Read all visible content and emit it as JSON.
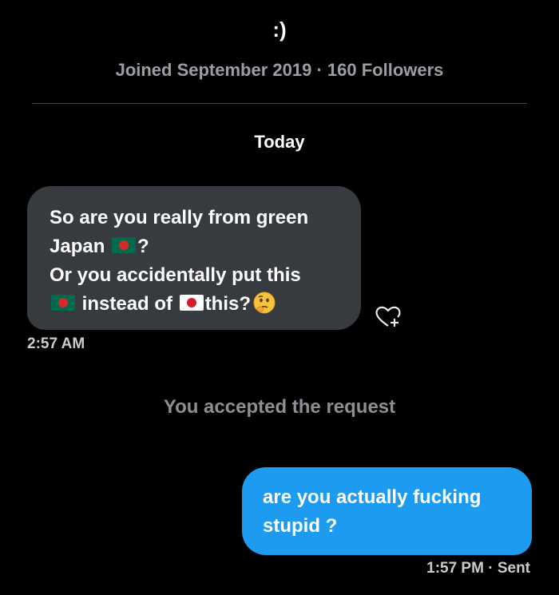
{
  "profile": {
    "name": ":)",
    "meta": "Joined September 2019 · 160 Followers"
  },
  "conversation": {
    "date_label": "Today",
    "incoming": {
      "line1": "So are you really from green",
      "line2_text": "Japan",
      "line2_flag": "bangladesh-flag",
      "line2_end": "?",
      "line3": "Or you accidentally put this",
      "line4_flag_a": "bangladesh-flag",
      "line4_text": "instead of",
      "line4_flag_b": "japan-flag",
      "line4_end": "this?",
      "line4_emoji": "thinking-face",
      "time": "2:57 AM"
    },
    "system_note": "You accepted the request",
    "outgoing": {
      "line1": "are you actually fucking",
      "line2": "stupid ?",
      "time": "1:57 PM",
      "status": "· Sent"
    }
  },
  "icons": {
    "react": "heart-plus-icon"
  },
  "colors": {
    "background": "#000000",
    "incoming_bubble": "#373a3e",
    "outgoing_bubble": "#1d9bf0",
    "muted_text": "#8b8f94"
  }
}
